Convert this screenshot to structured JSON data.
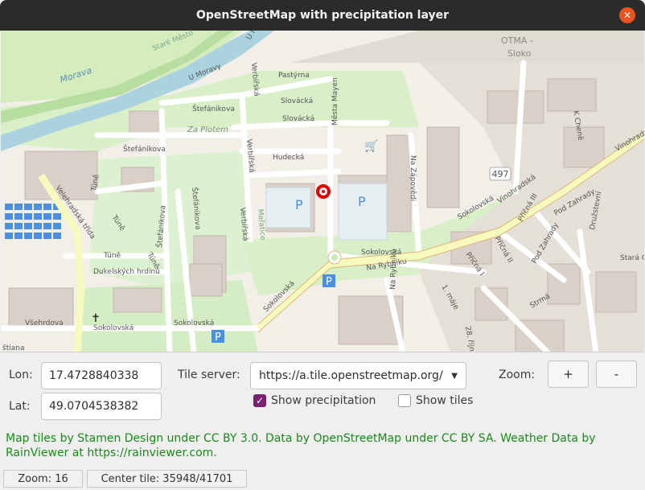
{
  "window": {
    "title": "OpenStreetMap with precipitation layer"
  },
  "map": {
    "labels": {
      "morava": "Morava",
      "stare_mesto": "Staré Město",
      "u_moravy": "U Moravy",
      "u_mlyna": "U Mlý",
      "pastyrna": "Pastýrna",
      "slovacka1": "Slovácká",
      "slovacka2": "Slovácká",
      "stefanikova1": "Štefánikova",
      "stefanikova2": "Štefánikova",
      "stefanikova3": "Štefánikova",
      "stefanikova4": "Štefánikova",
      "za_plotem": "Za Plotem",
      "verbirska1": "Verbířská",
      "verbirska2": "Verbířská",
      "verbirska3": "Verbířská",
      "hudecka": "Hudecká",
      "mesta_mayen": "Města Mayen",
      "na_zapovedi": "Na Zápovědi",
      "velehradska": "Velehradská třída",
      "tune1": "Túně",
      "tune2": "Túně",
      "tune3": "Túně",
      "dukelskych": "Dukelských hrdinů",
      "maratice": "Mařatice",
      "sokolovska1": "Sokolovská",
      "sokolovska2": "Sokolovská",
      "sokolovska3": "Sokolovská",
      "sokolovska4": "Sokolovská",
      "sokolovska5": "Sokolovská",
      "na_rybniku1": "Na Rybníku",
      "na_rybniku2": "Na Rybníku",
      "vsehrdova": "Všehrdova",
      "stiana": "štiana",
      "otma": "OTMA -",
      "sloko": "Sloko",
      "k_chenie": "K Cheně",
      "vinohradska1": "Vinohradská",
      "vinohradska2": "Vinohradská",
      "prichna1": "Příčná III",
      "prichna2": "Příčná II",
      "prichna3": "Příčná I",
      "prichna4": "Příčná II",
      "pod_zahrady1": "Pod Zahrady",
      "pod_zahrady2": "Pod Zahrady",
      "druzstevni": "Družstevní",
      "stara_c": "Stará C",
      "jedina": "1. máje",
      "srna": "Strmá",
      "dvacet": "28. října",
      "route": "497",
      "p": "P"
    }
  },
  "controls": {
    "lon_label": "Lon:",
    "lon_value": "17.4728840338",
    "lat_label": "Lat:",
    "lat_value": "49.0704538382",
    "tile_server_label": "Tile server:",
    "tile_server_value": "https://a.tile.openstreetmap.org/",
    "zoom_label": "Zoom:",
    "zoom_in": "+",
    "zoom_out": "-",
    "show_precipitation": "Show precipitation",
    "show_precipitation_checked": true,
    "show_tiles": "Show tiles",
    "show_tiles_checked": false
  },
  "attribution": "Map tiles by Stamen Design under CC BY 3.0. Data by OpenStreetMap under CC BY SA. Weather Data by RainViewer at https://rainviewer.com.",
  "status": {
    "zoom": "Zoom: 16",
    "center_tile": "Center tile: 35948/41701"
  },
  "colors": {
    "accent": "#77216f",
    "attribution": "#1a8a1a",
    "titlebar": "#2b2b2b",
    "close": "#e95420",
    "marker": "#e00000"
  }
}
